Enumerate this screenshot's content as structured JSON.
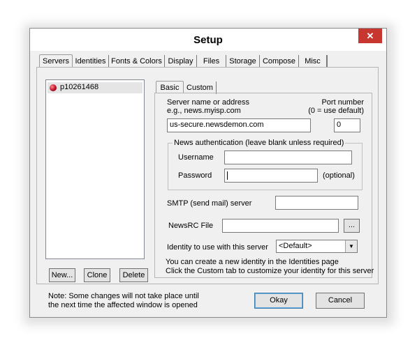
{
  "window": {
    "title": "Setup",
    "close_glyph": "✕"
  },
  "tabs": [
    "Servers",
    "Identities",
    "Fonts & Colors",
    "Display",
    "Files",
    "Storage",
    "Compose",
    "Misc"
  ],
  "servers": {
    "items": [
      {
        "name": "p10261468",
        "icon": "red-dot-icon",
        "icon_color": "#c0102a"
      }
    ],
    "buttons": {
      "new": "New...",
      "clone": "Clone",
      "delete": "Delete"
    }
  },
  "subtabs": [
    "Basic",
    "Custom"
  ],
  "basic": {
    "server_label": "Server name or address",
    "server_example": "e.g., news.myisp.com",
    "port_label": "Port number",
    "port_hint": "(0 = use default)",
    "server_value": "us-secure.newsdemon.com",
    "port_value": "0",
    "auth_group": "News authentication (leave blank unless required)",
    "username_label": "Username",
    "username_value": "",
    "password_label": "Password",
    "password_value": "",
    "optional_label": "(optional)",
    "smtp_label": "SMTP (send mail) server",
    "smtp_value": "",
    "newsrc_label": "NewsRC File",
    "newsrc_value": "",
    "browse_label": "...",
    "identity_label": "Identity to use with this server",
    "identity_value": "<Default>",
    "info_line1": "You can create a new identity in the Identities page",
    "info_line2": "Click the Custom tab to customize your identity for this server"
  },
  "footer": {
    "note_line1": "Note: Some changes will not take place until",
    "note_line2": "the next time the affected window is opened",
    "ok_label": "Okay",
    "cancel_label": "Cancel"
  }
}
